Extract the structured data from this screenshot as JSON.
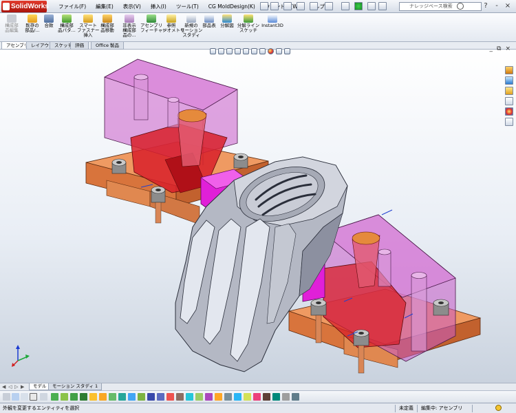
{
  "app": {
    "name": "SolidWorks",
    "menus": [
      "ファイル(F)",
      "編集(E)",
      "表示(V)",
      "挿入(I)",
      "ツール(T)",
      "CG MoldDesign(K)",
      "ウィンドウ(W)",
      "ヘルプ(H)"
    ],
    "search_placeholder": "ナレッジベース検索",
    "window_buttons": [
      "?",
      "-",
      "×"
    ]
  },
  "command_manager": {
    "buttons": [
      {
        "label": "構成部\n品編集",
        "enabled": false
      },
      {
        "label": "既存の\n部品/...",
        "enabled": true
      },
      {
        "label": "合致",
        "enabled": true
      },
      {
        "label": "構成部\n品パタ...",
        "enabled": true
      },
      {
        "label": "スマート\nファスナー\n挿入",
        "enabled": true
      },
      {
        "label": "構成部\n品移動",
        "enabled": true
      },
      {
        "label": "非表示\n構成部\n品の...",
        "enabled": true
      },
      {
        "label": "アセンブリ\nフィーチャー",
        "enabled": true
      },
      {
        "label": "参照\nジオメトリ",
        "enabled": true
      },
      {
        "label": "新規の\nモーション\nスタディ",
        "enabled": true
      },
      {
        "label": "部品表",
        "enabled": true
      },
      {
        "label": "分解図",
        "enabled": true
      },
      {
        "label": "分解ライン\nスケッチ",
        "enabled": true
      },
      {
        "label": "Instant3D",
        "enabled": true
      }
    ],
    "tabs": [
      "アセンブリ",
      "レイアウト",
      "スケッチ",
      "評価",
      "Office 製品"
    ],
    "active_tab": "アセンブリ"
  },
  "bottom_tabs": {
    "tabs": [
      "モデル",
      "モーション スタディ 1"
    ],
    "active_tab": "モデル"
  },
  "status_bar": {
    "message": "外観を変更するエンティティを選択",
    "state": "未定義",
    "editing": "編集中: アセンブリ"
  },
  "colors": {
    "mold_block": "#c95bc8",
    "base_plate": "#e0864a",
    "core_red": "#d8202a",
    "slider_magenta": "#e020d8",
    "part_gray": "#b4b8c4"
  }
}
